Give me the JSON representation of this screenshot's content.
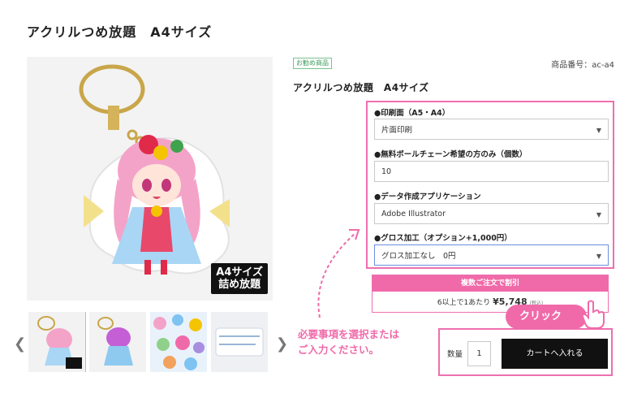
{
  "page": {
    "title": "アクリルつめ放題　A4サイズ"
  },
  "gallery": {
    "main_badge": "A4サイズ\n詰め放題",
    "prev_icon": "chevron-left-icon",
    "next_icon": "chevron-right-icon",
    "thumbnail_count": 4
  },
  "product": {
    "recommend_badge": "お勧め商品",
    "code": "商品番号：ac-a4",
    "name": "アクリルつめ放題　A4サイズ"
  },
  "options": [
    {
      "label": "●印刷面（A5・A4）",
      "type": "select",
      "value": "片面印刷"
    },
    {
      "label": "●無料ボールチェーン希望の方のみ（個数）",
      "type": "text",
      "value": "10"
    },
    {
      "label": "●データ作成アプリケーション",
      "type": "select",
      "value": "Adobe Illustrator"
    },
    {
      "label": "●グロス加工（オプション+1,000円）",
      "type": "select",
      "value": "グロス加工なし　0円"
    }
  ],
  "bulk": {
    "header": "複数ご注文で割引",
    "prefix": "6以上で1あたり",
    "price": "¥5,748",
    "tax": "(税込)"
  },
  "cart": {
    "qty_label": "数量",
    "qty_value": "1",
    "button_label": "カートへ入れる"
  },
  "annotations": {
    "click_label": "クリック",
    "instruction": "必要事項を選択または\nご入力ください。"
  },
  "colors": {
    "accent_pink": "#f06aa9",
    "border_pink": "#ee6fb0",
    "button_black": "#111111"
  }
}
